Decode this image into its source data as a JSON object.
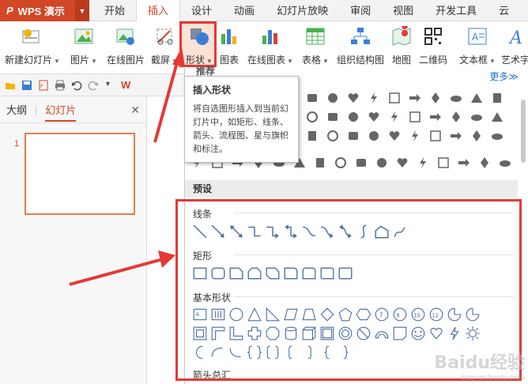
{
  "app": {
    "name": "WPS 演示",
    "logo": "P"
  },
  "tabs": [
    "开始",
    "插入",
    "设计",
    "动画",
    "幻灯片放映",
    "审阅",
    "视图",
    "开发工具",
    "云"
  ],
  "active_tab": "插入",
  "ribbon": [
    {
      "label": "新建幻灯片",
      "dropdown": true,
      "icon": "new-slide-icon"
    },
    {
      "label": "图片",
      "dropdown": true,
      "icon": "picture-icon"
    },
    {
      "label": "在线图片",
      "dropdown": false,
      "icon": "online-picture-icon"
    },
    {
      "label": "截屏",
      "dropdown": true,
      "icon": "screenshot-icon"
    },
    {
      "label": "形状",
      "dropdown": true,
      "icon": "shapes-icon"
    },
    {
      "label": "图表",
      "dropdown": false,
      "icon": "chart-icon"
    },
    {
      "label": "在线图表",
      "dropdown": true,
      "icon": "online-chart-icon"
    },
    {
      "label": "表格",
      "dropdown": true,
      "icon": "table-icon"
    },
    {
      "label": "组织结构图",
      "dropdown": false,
      "icon": "org-chart-icon"
    },
    {
      "label": "地图",
      "dropdown": false,
      "icon": "map-icon"
    },
    {
      "label": "二维码",
      "dropdown": false,
      "icon": "qrcode-icon"
    },
    {
      "label": "文本框",
      "dropdown": true,
      "icon": "textbox-icon"
    },
    {
      "label": "艺术字",
      "dropdown": false,
      "icon": "wordart-icon"
    }
  ],
  "quick_access": [
    "open-icon",
    "save-icon",
    "pdf-icon",
    "print-icon",
    "undo-icon",
    "redo-icon",
    "customize-icon"
  ],
  "left_pane": {
    "tab_outline": "大纲",
    "tab_slides": "幻灯片",
    "slide_number": "1"
  },
  "tooltip": {
    "title": "插入形状",
    "body": "将自选图形插入到当前幻灯片中，如矩形、线条、箭头、流程图、星与旗帜和标注。"
  },
  "panel": {
    "header_partial": "推荐",
    "more": "更多≫",
    "presets_title": "预设",
    "lines_title": "线条",
    "rect_title": "矩形",
    "basic_title": "基本形状",
    "arrows_title": "箭头总汇"
  },
  "colors": {
    "accent": "#d24726",
    "annotation": "#e53935",
    "link": "#1a73c8",
    "shape_stroke": "#4a6fa5"
  },
  "watermark": {
    "brand": "Baidu经验",
    "url": "jingyan.baidu.com"
  }
}
